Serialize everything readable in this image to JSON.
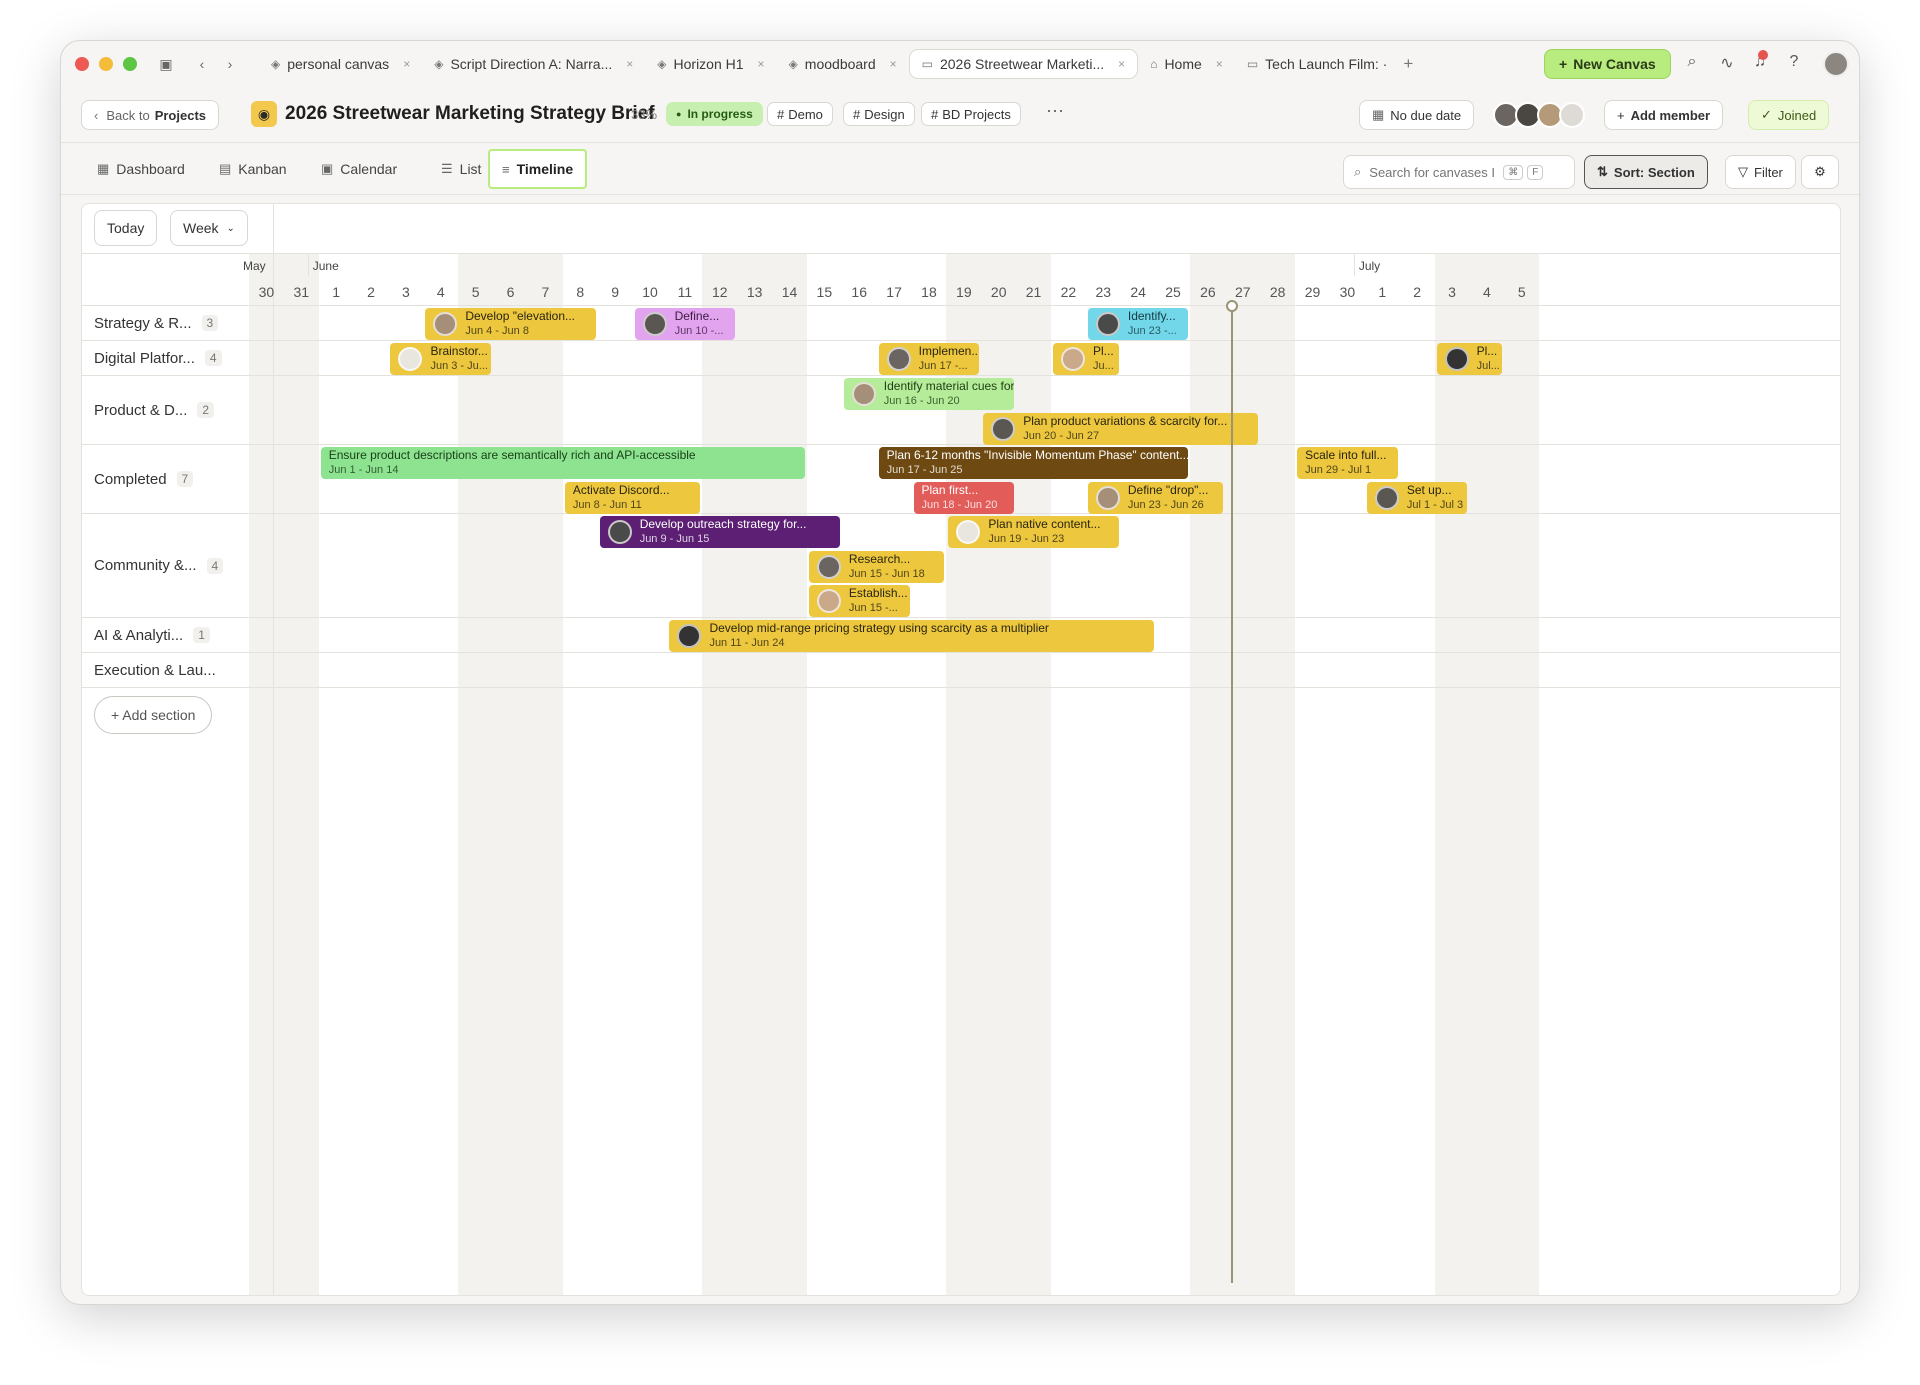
{
  "window": {
    "tabs": [
      {
        "label": "personal canvas",
        "icon": "layers-icon",
        "active": false
      },
      {
        "label": "Script Direction A: Narra...",
        "icon": "layers-icon",
        "active": false
      },
      {
        "label": "Horizon H1",
        "icon": "layers-icon",
        "active": false
      },
      {
        "label": "moodboard",
        "icon": "layers-icon",
        "active": false
      },
      {
        "label": "2026 Streetwear Marketi...",
        "icon": "folder-icon",
        "active": true
      },
      {
        "label": "Home",
        "icon": "home-icon",
        "active": false
      },
      {
        "label": "Tech Launch Film: ·",
        "icon": "folder-icon",
        "active": false
      }
    ],
    "new_canvas_label": "New Canvas",
    "accent_color": "#b8ec7f"
  },
  "header": {
    "back_label": "Back to",
    "back_target": "Projects",
    "title": "2026 Streetwear Marketing Strategy Brief",
    "progress": "33%",
    "status": "In progress",
    "tags": [
      "Demo",
      "Design",
      "BD Projects"
    ],
    "due": "No due date",
    "add_member": "Add member",
    "joined": "Joined"
  },
  "views": {
    "tabs": [
      "Dashboard",
      "Kanban",
      "Calendar",
      "List",
      "Timeline"
    ],
    "active": "Timeline",
    "search_placeholder": "Search for canvases I",
    "kbd1": "⌘",
    "kbd2": "F",
    "sort": "Sort: Section",
    "filter": "Filter"
  },
  "timeline": {
    "today_label": "Today",
    "scale_label": "Week",
    "months": [
      "May",
      "June",
      "July"
    ],
    "days": [
      "30",
      "31",
      "1",
      "2",
      "3",
      "4",
      "5",
      "6",
      "7",
      "8",
      "9",
      "10",
      "11",
      "12",
      "13",
      "14",
      "15",
      "16",
      "17",
      "18",
      "19",
      "20",
      "21",
      "22",
      "23",
      "24",
      "25",
      "26",
      "27",
      "28",
      "29",
      "30",
      "1",
      "2",
      "3",
      "4",
      "5"
    ],
    "today_day_index": 28,
    "sections": [
      {
        "name": "Strategy & R...",
        "count": "3"
      },
      {
        "name": "Digital Platfor...",
        "count": "4"
      },
      {
        "name": "Product & D...",
        "count": "2"
      },
      {
        "name": "Completed",
        "count": "7"
      },
      {
        "name": "Community &...",
        "count": "4"
      },
      {
        "name": "AI & Analyti...",
        "count": "1"
      },
      {
        "name": "Execution & Lau...",
        "count": ""
      }
    ],
    "add_section": "+ Add section",
    "tasks": [
      {
        "section": 0,
        "title": "Develop \"elevation...",
        "dates": "Jun 4 - Jun 8",
        "color": "yellow"
      },
      {
        "section": 0,
        "title": "Define...",
        "dates": "Jun 10 -...",
        "color": "pink"
      },
      {
        "section": 0,
        "title": "Identify...",
        "dates": "Jun 23 -...",
        "color": "cyan"
      },
      {
        "section": 1,
        "title": "Brainstor...",
        "dates": "Jun 3 - Ju...",
        "color": "yellow"
      },
      {
        "section": 1,
        "title": "Implemen...",
        "dates": "Jun 17 -...",
        "color": "yellow"
      },
      {
        "section": 1,
        "title": "Pl...",
        "dates": "Ju...",
        "color": "yellow"
      },
      {
        "section": 1,
        "title": "Pl...",
        "dates": "Jul...",
        "color": "yellow"
      },
      {
        "section": 2,
        "title": "Identify material cues for...",
        "dates": "Jun 16 - Jun 20",
        "color": "lgreen"
      },
      {
        "section": 2,
        "title": "Plan product variations & scarcity for...",
        "dates": "Jun 20 - Jun 27",
        "color": "yellow"
      },
      {
        "section": 3,
        "title": "Ensure product descriptions are semantically rich and API-accessible",
        "dates": "Jun 1 - Jun 14",
        "color": "green"
      },
      {
        "section": 3,
        "title": "Plan 6-12 months \"Invisible Momentum Phase\" content...",
        "dates": "Jun 17 - Jun 25",
        "color": "brown"
      },
      {
        "section": 3,
        "title": "Scale into full...",
        "dates": "Jun 29 - Jul 1",
        "color": "yellow"
      },
      {
        "section": 3,
        "title": "Activate Discord...",
        "dates": "Jun 8 - Jun 11",
        "color": "yellow"
      },
      {
        "section": 3,
        "title": "Plan first...",
        "dates": "Jun 18 - Jun 20",
        "color": "red"
      },
      {
        "section": 3,
        "title": "Define \"drop\"...",
        "dates": "Jun 23 - Jun 26",
        "color": "yellow"
      },
      {
        "section": 3,
        "title": "Set up...",
        "dates": "Jul 1 - Jul 3",
        "color": "yellow"
      },
      {
        "section": 4,
        "title": "Develop outreach strategy for...",
        "dates": "Jun 9 - Jun 15",
        "color": "purple"
      },
      {
        "section": 4,
        "title": "Plan native content...",
        "dates": "Jun 19 - Jun 23",
        "color": "yellow"
      },
      {
        "section": 4,
        "title": "Research...",
        "dates": "Jun 15 - Jun 18",
        "color": "yellow"
      },
      {
        "section": 4,
        "title": "Establish...",
        "dates": "Jun 15 -...",
        "color": "yellow"
      },
      {
        "section": 5,
        "title": "Develop mid-range pricing strategy using scarcity as a multiplier",
        "dates": "Jun 11 - Jun 24",
        "color": "yellow"
      }
    ]
  }
}
